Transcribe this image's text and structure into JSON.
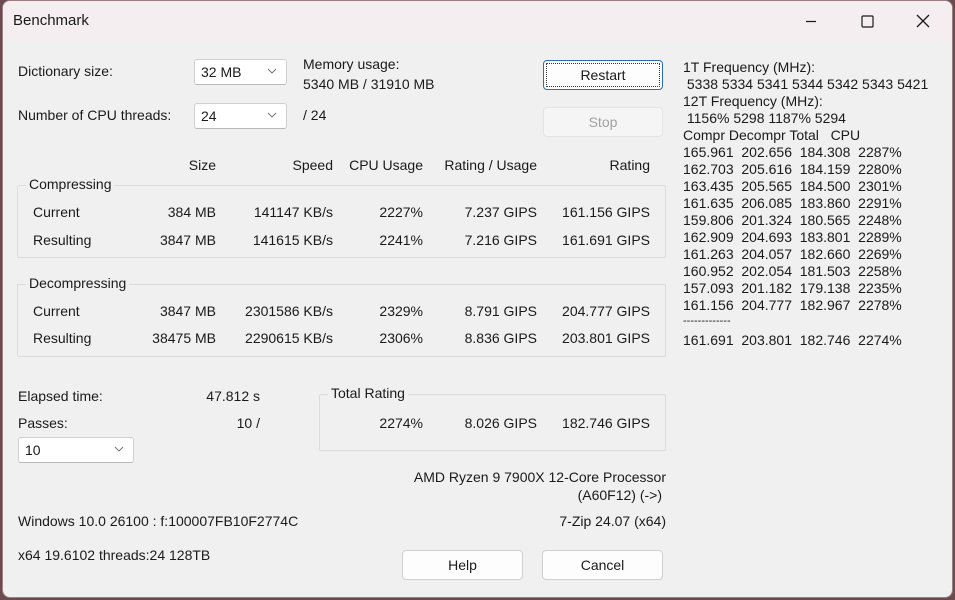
{
  "window": {
    "title": "Benchmark",
    "controls": {
      "minimize": "minimize-icon",
      "maximize": "maximize-icon",
      "close": "close-icon"
    }
  },
  "settings": {
    "dictionary_label": "Dictionary size:",
    "dictionary_value": "32 MB",
    "threads_label": "Number of CPU threads:",
    "threads_value": "24",
    "threads_max": "/ 24",
    "memory_label": "Memory usage:",
    "memory_value": "5340 MB / 31910 MB"
  },
  "buttons": {
    "restart": "Restart",
    "stop": "Stop",
    "help": "Help",
    "cancel": "Cancel"
  },
  "columns": [
    "Size",
    "Speed",
    "CPU Usage",
    "Rating / Usage",
    "Rating"
  ],
  "compressing": {
    "label": "Compressing",
    "rows": [
      {
        "name": "Current",
        "size": "384 MB",
        "speed": "141147 KB/s",
        "cpu": "2227%",
        "rpu": "7.237 GIPS",
        "rating": "161.156 GIPS"
      },
      {
        "name": "Resulting",
        "size": "3847 MB",
        "speed": "141615 KB/s",
        "cpu": "2241%",
        "rpu": "7.216 GIPS",
        "rating": "161.691 GIPS"
      }
    ]
  },
  "decompressing": {
    "label": "Decompressing",
    "rows": [
      {
        "name": "Current",
        "size": "3847 MB",
        "speed": "2301586 KB/s",
        "cpu": "2329%",
        "rpu": "8.791 GIPS",
        "rating": "204.777 GIPS"
      },
      {
        "name": "Resulting",
        "size": "38475 MB",
        "speed": "2290615 KB/s",
        "cpu": "2306%",
        "rpu": "8.836 GIPS",
        "rating": "203.801 GIPS"
      }
    ]
  },
  "elapsed": {
    "label": "Elapsed time:",
    "value": "47.812 s"
  },
  "passes": {
    "label": "Passes:",
    "value": "10 /",
    "select_value": "10"
  },
  "total_rating": {
    "label": "Total Rating",
    "cpu": "2274%",
    "rpu": "8.026 GIPS",
    "rating": "182.746 GIPS"
  },
  "system": {
    "cpu_name": "AMD Ryzen 9 7900X 12-Core Processor",
    "cpu_id": "(A60F12) (->)",
    "os": "Windows 10.0 26100 : f:100007FB10F2774C",
    "version": "7-Zip 24.07 (x64)",
    "arch": "x64 19.6102 threads:24 128TB"
  },
  "log": {
    "freq1_label": "1T Frequency (MHz):",
    "freq1_values": " 5338 5334 5341 5344 5342 5343 5421",
    "freq12_label": "12T Frequency (MHz):",
    "freq12_values": " 1156% 5298 1187% 5294",
    "header": "Compr Decompr Total   CPU",
    "rows": [
      "165.961  202.656  184.308  2287%",
      "162.703  205.616  184.159  2280%",
      "163.435  205.565  184.500  2301%",
      "161.635  206.085  183.860  2291%",
      "159.806  201.324  180.565  2248%",
      "162.909  204.693  183.801  2289%",
      "161.263  204.057  182.660  2269%",
      "160.952  202.054  181.503  2258%",
      "157.093  201.182  179.138  2235%",
      "161.156  204.777  182.967  2278%"
    ],
    "separator": "-------------",
    "total": "161.691  203.801  182.746  2274%"
  }
}
